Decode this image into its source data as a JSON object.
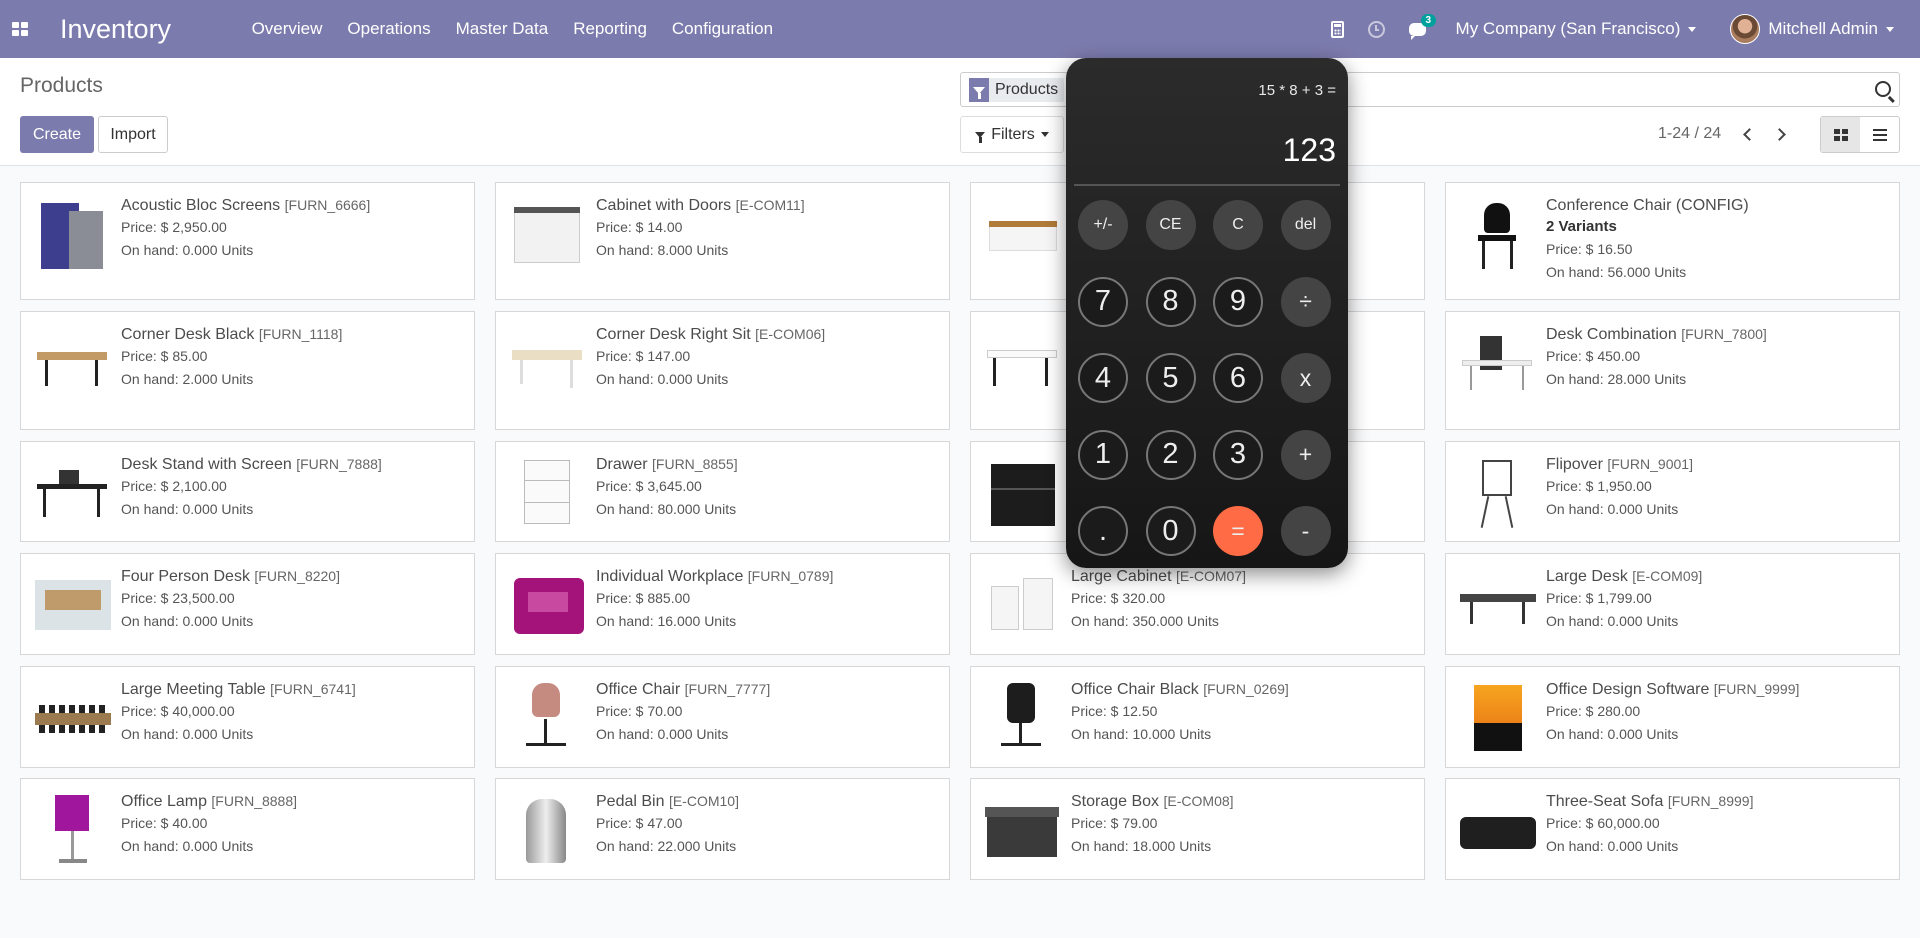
{
  "navbar": {
    "app_name": "Inventory",
    "menu": [
      "Overview",
      "Operations",
      "Master Data",
      "Reporting",
      "Configuration"
    ],
    "messages_badge": "3",
    "company": "My Company (San Francisco)",
    "user": "Mitchell Admin"
  },
  "control": {
    "title": "Products",
    "create_label": "Create",
    "import_label": "Import",
    "search_facet": "Products",
    "filters_label": "Filters",
    "pager": "1-24 / 24"
  },
  "products": [
    {
      "name": "Acoustic Bloc Screens",
      "code": "[FURN_6666]",
      "price": "Price: $ 2,950.00",
      "onhand": "On hand: 0.000 Units",
      "variants": "",
      "icon": "screen"
    },
    {
      "name": "Cabinet with Doors",
      "code": "[E-COM11]",
      "price": "Price: $ 14.00",
      "onhand": "On hand: 8.000 Units",
      "variants": "",
      "icon": "cabinet"
    },
    {
      "name": "",
      "code": "",
      "price": "",
      "onhand": "",
      "variants": "",
      "icon": "box-bench"
    },
    {
      "name": "Conference Chair (CONFIG)",
      "code": "",
      "price": "Price: $ 16.50",
      "onhand": "On hand: 56.000 Units",
      "variants": "2 Variants",
      "icon": "chair"
    },
    {
      "name": "Corner Desk Black",
      "code": "[FURN_1118]",
      "price": "Price: $ 85.00",
      "onhand": "On hand: 2.000 Units",
      "variants": "",
      "icon": "desk"
    },
    {
      "name": "Corner Desk Right Sit",
      "code": "[E-COM06]",
      "price": "Price: $ 147.00",
      "onhand": "On hand: 0.000 Units",
      "variants": "",
      "icon": "desk-light"
    },
    {
      "name": "",
      "code": "",
      "price": "",
      "onhand": "",
      "variants": "",
      "icon": "desk-white"
    },
    {
      "name": "Desk Combination",
      "code": "[FURN_7800]",
      "price": "Price: $ 450.00",
      "onhand": "On hand: 28.000 Units",
      "variants": "",
      "icon": "desk-combo"
    },
    {
      "name": "Desk Stand with Screen",
      "code": "[FURN_7888]",
      "price": "Price: $ 2,100.00",
      "onhand": "On hand: 0.000 Units",
      "variants": "",
      "icon": "desk-screen"
    },
    {
      "name": "Drawer",
      "code": "[FURN_8855]",
      "price": "Price: $ 3,645.00",
      "onhand": "On hand: 80.000 Units",
      "variants": "",
      "icon": "drawer"
    },
    {
      "name": "",
      "code": "",
      "price": "",
      "onhand": "",
      "variants": "",
      "icon": "drawer-black"
    },
    {
      "name": "Flipover",
      "code": "[FURN_9001]",
      "price": "Price: $ 1,950.00",
      "onhand": "On hand: 0.000 Units",
      "variants": "",
      "icon": "flipover"
    },
    {
      "name": "Four Person Desk",
      "code": "[FURN_8220]",
      "price": "Price: $ 23,500.00",
      "onhand": "On hand: 0.000 Units",
      "variants": "",
      "icon": "office"
    },
    {
      "name": "Individual Workplace",
      "code": "[FURN_0789]",
      "price": "Price: $ 885.00",
      "onhand": "On hand: 16.000 Units",
      "variants": "",
      "icon": "workplace"
    },
    {
      "name": "Large Cabinet",
      "code": "[E-COM07]",
      "price": "Price: $ 320.00",
      "onhand": "On hand: 350.000 Units",
      "variants": "",
      "icon": "large-cabinet"
    },
    {
      "name": "Large Desk",
      "code": "[E-COM09]",
      "price": "Price: $ 1,799.00",
      "onhand": "On hand: 0.000 Units",
      "variants": "",
      "icon": "large-desk"
    },
    {
      "name": "Large Meeting Table",
      "code": "[FURN_6741]",
      "price": "Price: $ 40,000.00",
      "onhand": "On hand: 0.000 Units",
      "variants": "",
      "icon": "meeting"
    },
    {
      "name": "Office Chair",
      "code": "[FURN_7777]",
      "price": "Price: $ 70.00",
      "onhand": "On hand: 0.000 Units",
      "variants": "",
      "icon": "pink-chair"
    },
    {
      "name": "Office Chair Black",
      "code": "[FURN_0269]",
      "price": "Price: $ 12.50",
      "onhand": "On hand: 10.000 Units",
      "variants": "",
      "icon": "black-chair"
    },
    {
      "name": "Office Design Software",
      "code": "[FURN_9999]",
      "price": "Price: $ 280.00",
      "onhand": "On hand: 0.000 Units",
      "variants": "",
      "icon": "software"
    },
    {
      "name": "Office Lamp",
      "code": "[FURN_8888]",
      "price": "Price: $ 40.00",
      "onhand": "On hand: 0.000 Units",
      "variants": "",
      "icon": "lamp"
    },
    {
      "name": "Pedal Bin",
      "code": "[E-COM10]",
      "price": "Price: $ 47.00",
      "onhand": "On hand: 22.000 Units",
      "variants": "",
      "icon": "bin"
    },
    {
      "name": "Storage Box",
      "code": "[E-COM08]",
      "price": "Price: $ 79.00",
      "onhand": "On hand: 18.000 Units",
      "variants": "",
      "icon": "storage"
    },
    {
      "name": "Three-Seat Sofa",
      "code": "[FURN_8999]",
      "price": "Price: $ 60,000.00",
      "onhand": "On hand: 0.000 Units",
      "variants": "",
      "icon": "sofa"
    }
  ],
  "calculator": {
    "expression": "15 * 8 + 3 =",
    "display": "123",
    "keys": [
      "+/-",
      "CE",
      "C",
      "del",
      "7",
      "8",
      "9",
      "÷",
      "4",
      "5",
      "6",
      "x",
      "1",
      "2",
      "3",
      "+",
      ".",
      "0",
      "=",
      "-"
    ]
  },
  "colors": {
    "brand": "#7c7bad",
    "equals": "#ff6b45",
    "badge": "#00a09d"
  }
}
